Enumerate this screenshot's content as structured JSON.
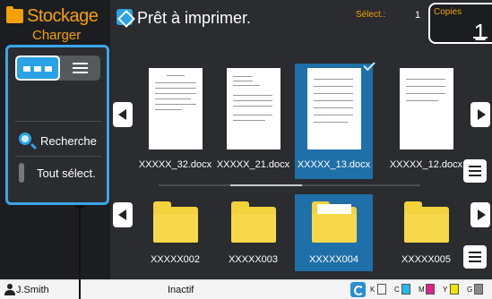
{
  "sidebar": {
    "title": "Stockage",
    "subtitle": "Charger",
    "search_label": "Recherche",
    "select_all_label": "Tout sélect."
  },
  "topbar": {
    "status_text": "Prêt à imprimer.",
    "select_label": "Sélect.:",
    "select_value": "1",
    "copies_label": "Copies",
    "copies_value": "1"
  },
  "documents": [
    {
      "label": "XXXXX_32.docx",
      "selected": false
    },
    {
      "label": "XXXXX_21.docx",
      "selected": false
    },
    {
      "label": "XXXXX_13.docx",
      "selected": true
    },
    {
      "label": "XXXXX_12.docx",
      "selected": false
    }
  ],
  "folders": [
    {
      "label": "XXXXX002",
      "selected": false
    },
    {
      "label": "XXXXX003",
      "selected": false
    },
    {
      "label": "XXXXX004",
      "selected": true
    },
    {
      "label": "XXXXX005",
      "selected": false
    }
  ],
  "statusbar": {
    "user": "J.Smith",
    "state": "Inactif",
    "inks": [
      {
        "label": "K",
        "color": "#222222"
      },
      {
        "label": "C",
        "color": "#28b8e8"
      },
      {
        "label": "M",
        "color": "#e0218a"
      },
      {
        "label": "Y",
        "color": "#f2e400"
      },
      {
        "label": "G",
        "color": "#8a8a8a"
      }
    ]
  },
  "colors": {
    "accent": "#f5a100",
    "selection_blue": "#1f6fa8",
    "highlight_blue": "#2aa2e6"
  }
}
